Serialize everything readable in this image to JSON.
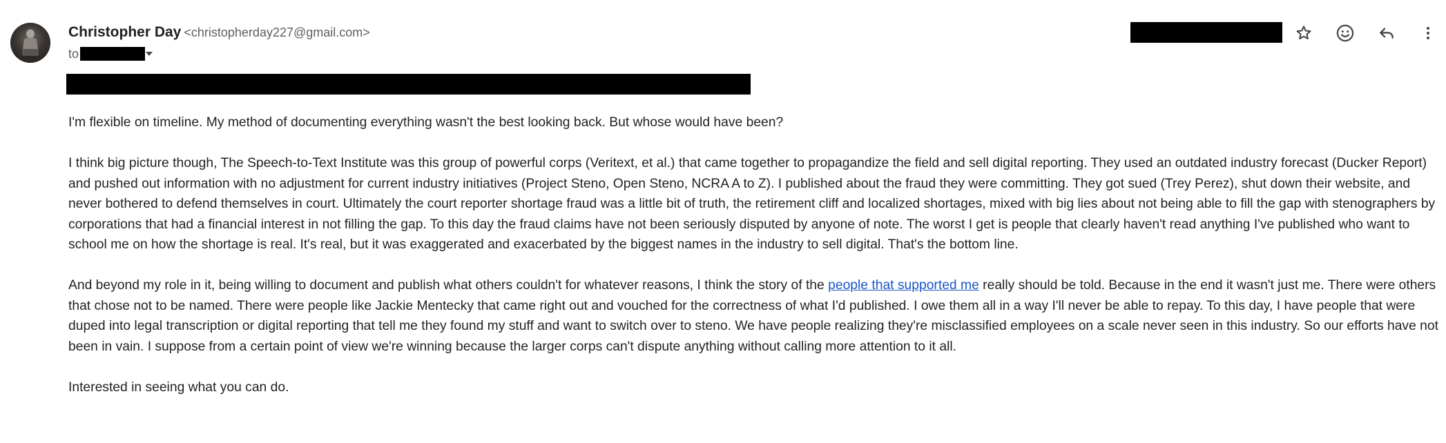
{
  "sender": {
    "name": "Christopher Day",
    "email": "<christopherday227@gmail.com>"
  },
  "recipient": {
    "to_label": "to"
  },
  "actions": {
    "star_icon": "star-icon",
    "emoji_icon": "emoji-icon",
    "reply_icon": "reply-icon",
    "more_icon": "more-vert-icon"
  },
  "body": {
    "p1": "I'm flexible on timeline. My method of documenting everything wasn't the best looking back. But whose would have been?",
    "p2": "I think big picture though, The Speech-to-Text Institute was this group of powerful corps (Veritext, et al.) that came together to propagandize the field and sell digital reporting. They used an outdated industry forecast (Ducker Report) and pushed out information with no adjustment for current industry initiatives (Project Steno, Open Steno, NCRA A to Z). I published about the fraud they were committing. They got sued (Trey Perez), shut down their website, and never bothered to defend themselves in court. Ultimately the court reporter shortage fraud was a little bit of truth, the retirement cliff and localized shortages, mixed with big lies about not being able to fill the gap with stenographers by corporations that had a financial interest in not filling the gap. To this day the fraud claims have not been seriously disputed by anyone of note. The worst I get is people that clearly haven't read anything I've published who want to school me on how the shortage is real. It's real, but it was exaggerated and exacerbated by the biggest names in the industry to sell digital. That's the bottom line.",
    "p3_before": "And beyond my role in it, being willing to document and publish what others couldn't for whatever reasons, I think the story of the ",
    "p3_link": "people that supported me",
    "p3_after": " really should be told. Because in the end it wasn't just me. There were others that chose not to be named. There were people like Jackie Mentecky that came right out and vouched for the correctness of what I'd published. I owe them all in a way I'll never be able to repay. To this day, I have people that were duped into legal transcription or digital reporting that tell me they found my stuff and want to switch over to steno. We have people realizing they're misclassified employees on a scale never seen in this industry. So our efforts have not been in vain. I suppose from a certain point of view we're winning because the larger corps can't dispute anything without calling more attention to it all.",
    "p4": "Interested in seeing what you can do."
  },
  "colors": {
    "link": "#1a55c9",
    "redaction": "#000000",
    "text": "#222222",
    "meta": "#5e5e5e"
  }
}
